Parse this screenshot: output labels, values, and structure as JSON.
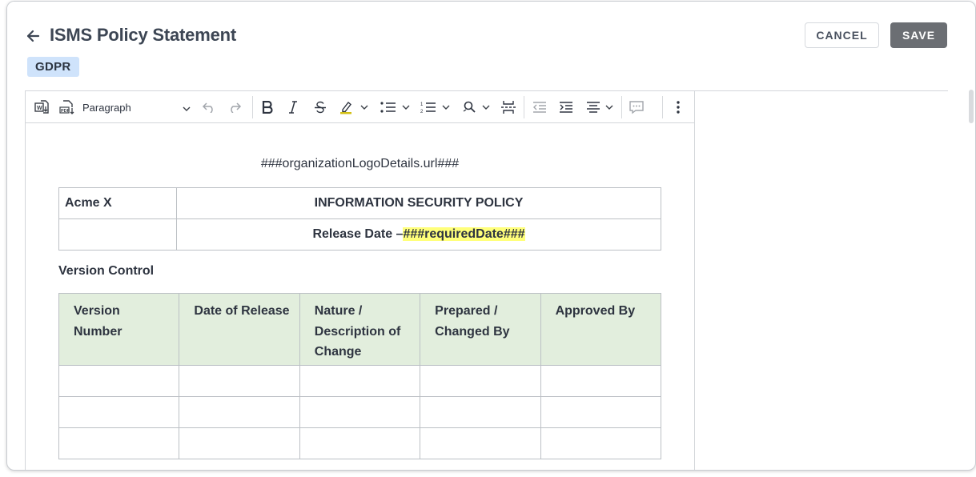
{
  "header": {
    "title": "ISMS Policy Statement",
    "badge": "GDPR",
    "cancel_label": "CANCEL",
    "save_label": "SAVE"
  },
  "toolbar": {
    "paragraph_select": "Paragraph",
    "icons": [
      "export-word-icon",
      "export-pdf-icon",
      "undo-icon",
      "redo-icon",
      "bold-icon",
      "italic-icon",
      "strikethrough-icon",
      "highlight-icon",
      "bulleted-list-icon",
      "numbered-list-icon",
      "find-replace-icon",
      "page-break-icon",
      "outdent-icon",
      "indent-icon",
      "align-icon",
      "comment-icon",
      "more-options-icon"
    ]
  },
  "document": {
    "logo_placeholder": "###organizationLogoDetails.url###",
    "header_table": {
      "org": "Acme X",
      "policy_title": "INFORMATION SECURITY POLICY",
      "release_prefix": "Release Date –",
      "release_value": "###requiredDate###"
    },
    "version_control": {
      "title": "Version Control",
      "columns": [
        "Version Number",
        "Date of Release",
        "Nature / Description of Change",
        "Prepared / Changed By",
        "Approved By"
      ],
      "rows": [
        [
          "",
          "",
          "",
          "",
          ""
        ],
        [
          "",
          "",
          "",
          "",
          ""
        ],
        [
          "",
          "",
          "",
          "",
          ""
        ]
      ]
    }
  },
  "colors": {
    "badge_bg": "#cfe3fb",
    "save_bg": "#6b6e73",
    "table_header_bg": "#e2eedd",
    "highlight": "#ffff7a"
  }
}
